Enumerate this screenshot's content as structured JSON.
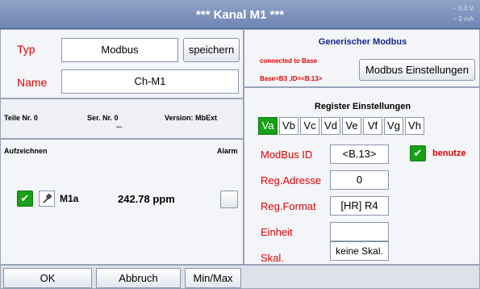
{
  "header": {
    "title": "*** Kanal M1 ***",
    "readout_voltage": "~ 0.0 V",
    "readout_current": "~ 0 mA"
  },
  "form": {
    "type_label": "Typ",
    "type_value": "Modbus",
    "save_button": "speichern",
    "name_label": "Name",
    "name_value": "Ch-M1"
  },
  "info": {
    "part_no": "Teile Nr. 0",
    "serial_no": "Ser. Nr. 0",
    "serial_extra": "...",
    "version": "Version: MbExt"
  },
  "record": {
    "label": "Aufzeichnen",
    "alarm_label": "Alarm",
    "channel_name": "M1a",
    "value": "242.78 ppm",
    "check_glyph": "✔",
    "probe_icon": "probe-icon"
  },
  "modbus": {
    "header": "Generischer Modbus",
    "status": "connected to Base",
    "base_info": "Base=B3 ,ID=<B.13>",
    "settings_button": "Modbus Einstellungen"
  },
  "register": {
    "header": "Register Einstellungen",
    "tabs": [
      "Va",
      "Vb",
      "Vc",
      "Vd",
      "Ve",
      "Vf",
      "Vg",
      "Vh"
    ],
    "active_tab": "Va",
    "modbus_id_label": "ModBus ID",
    "modbus_id_value": "<B.13>",
    "use_label": "benutze",
    "reg_address_label": "Reg.Adresse",
    "reg_address_value": "0",
    "reg_format_label": "Reg.Format",
    "reg_format_value": "[HR] R4",
    "unit_label": "Einheit",
    "unit_value": "",
    "scale_label": "Skal.",
    "scale_value": "keine Skal."
  },
  "footer": {
    "ok": "OK",
    "cancel": "Abbruch",
    "minmax": "Min/Max"
  },
  "colors": {
    "accent_red": "#e00000",
    "active_green": "#18a018",
    "title_blue": "#12288f",
    "titlebar": "#7b90bb"
  }
}
